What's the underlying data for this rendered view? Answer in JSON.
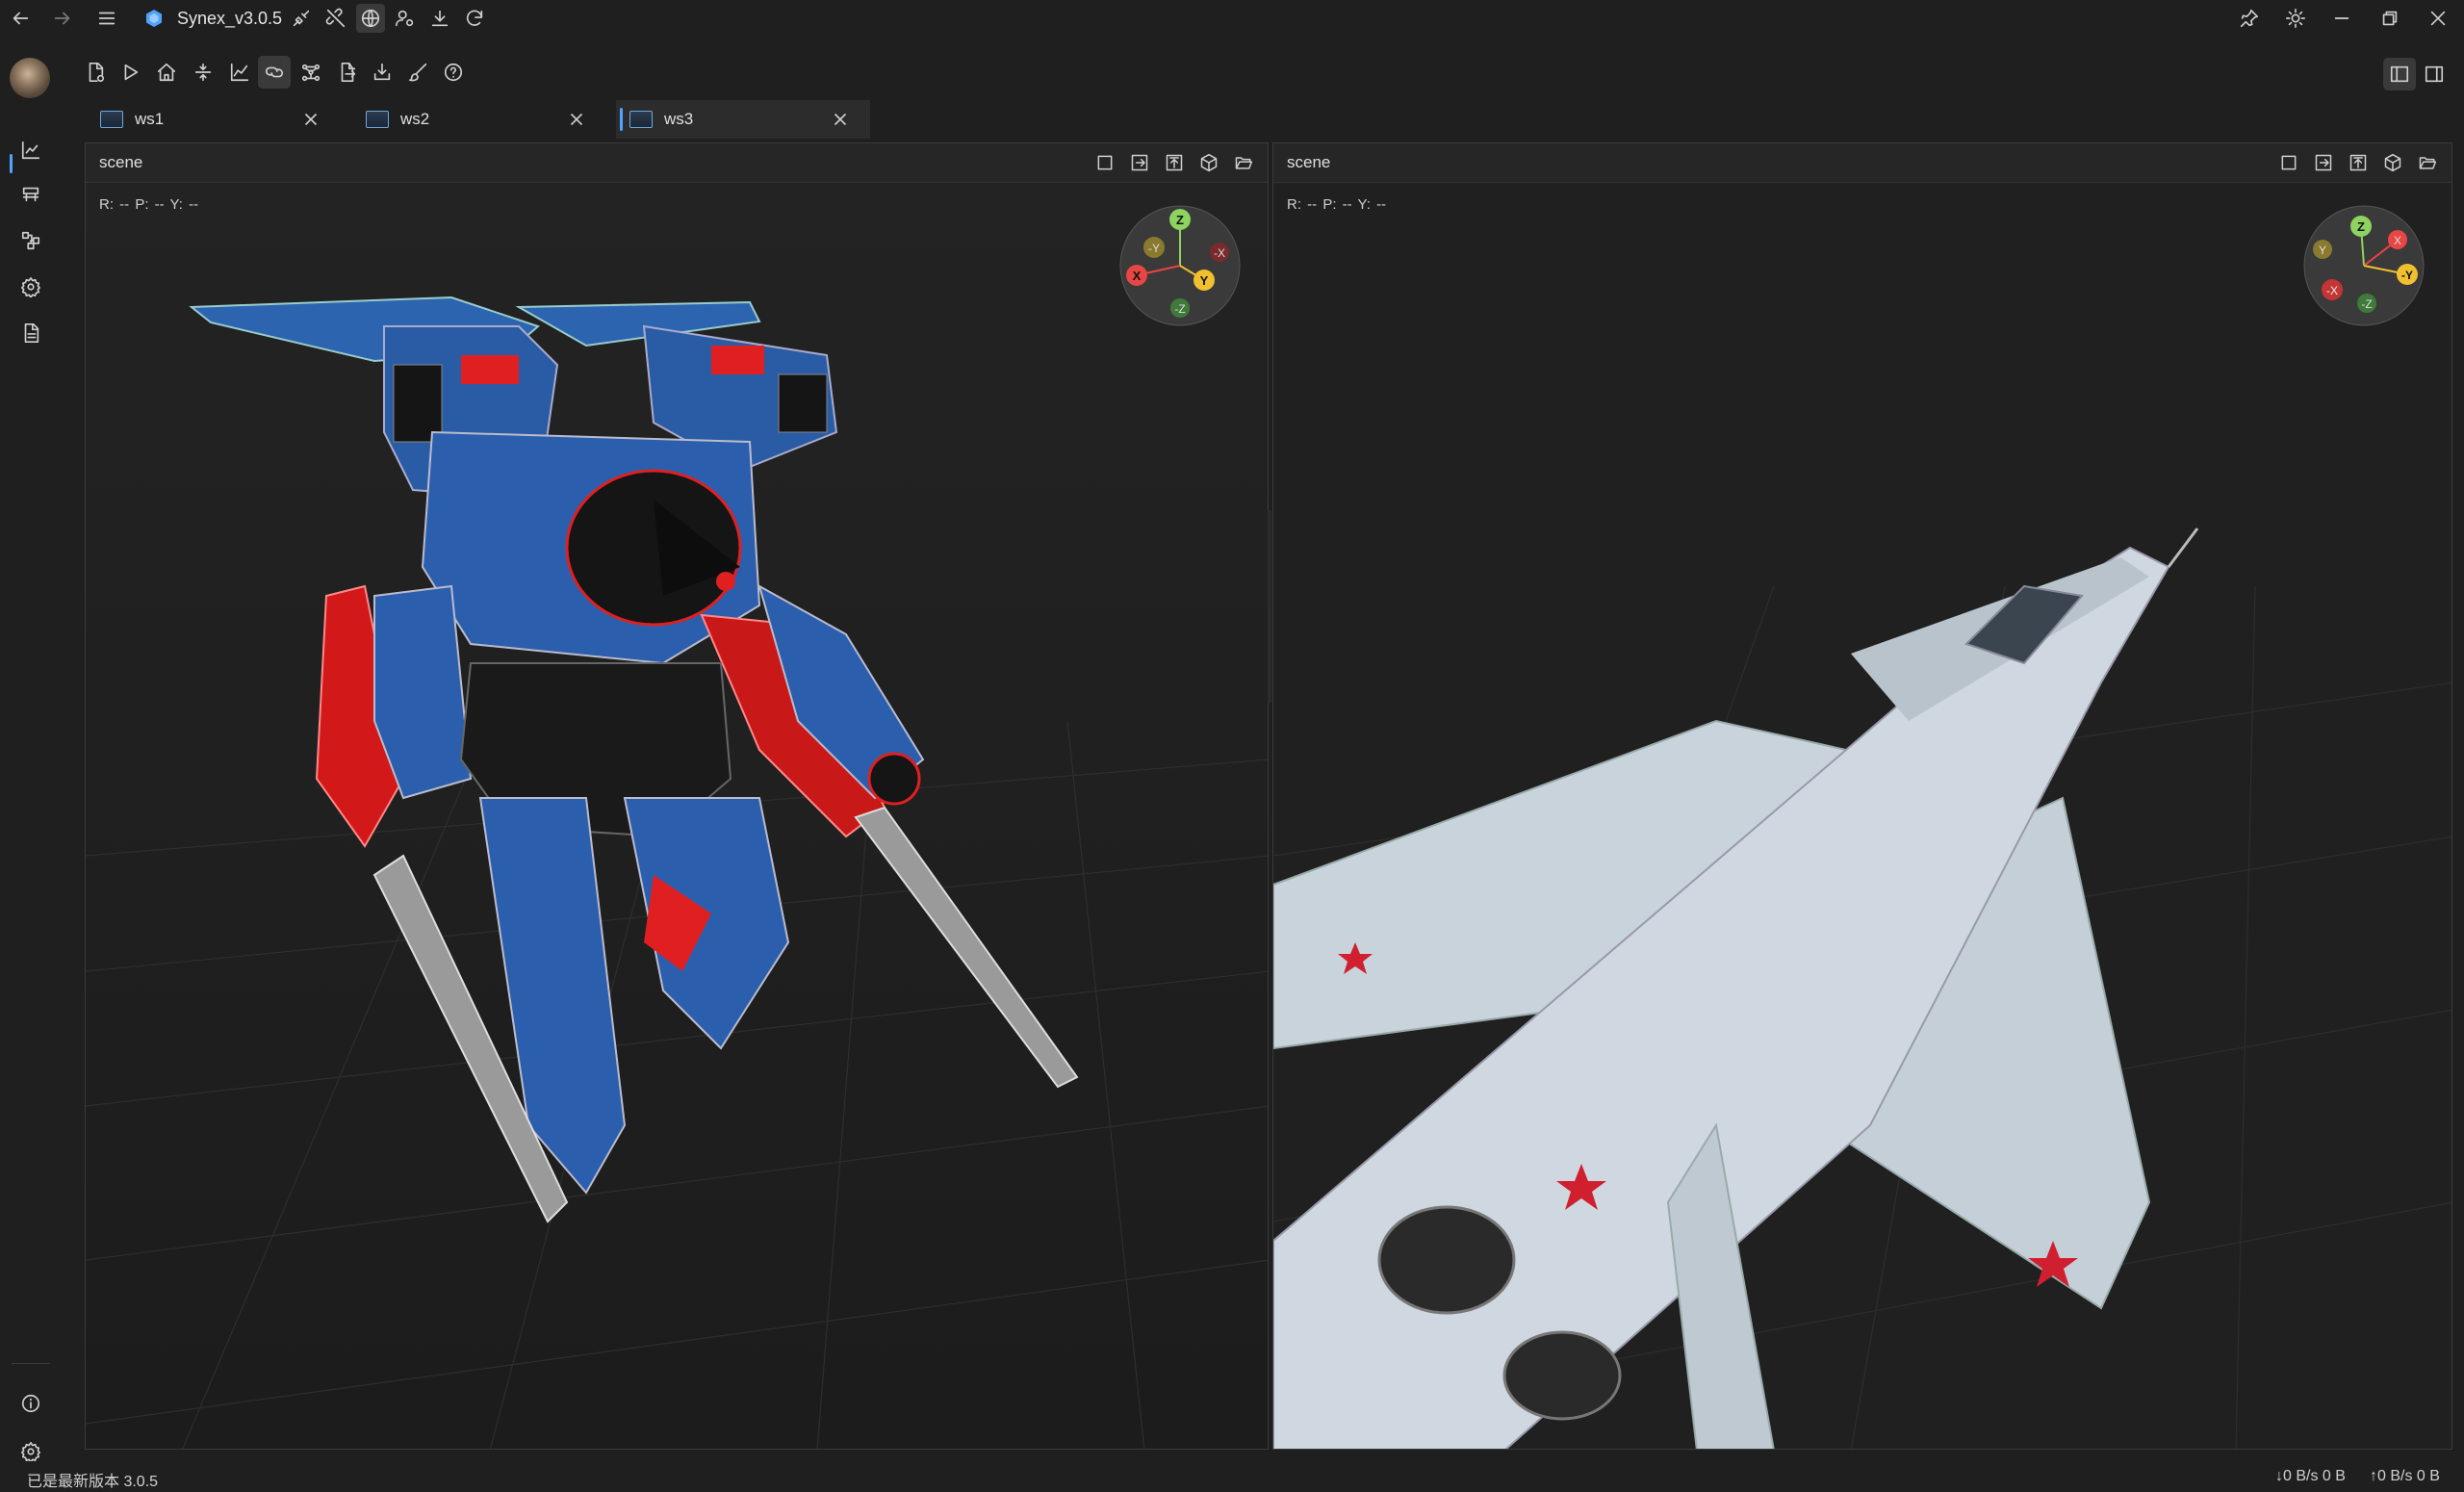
{
  "titlebar": {
    "app_title": "Synex_v3.0.5",
    "icons": [
      "back-arrow-icon",
      "forward-arrow-icon",
      "menu-icon",
      "app-logo-icon",
      "connect-icon",
      "disconnect-icon",
      "network-icon",
      "user-settings-icon",
      "download-icon",
      "refresh-icon",
      "pin-icon",
      "theme-sun-icon",
      "minimize-icon",
      "restore-icon",
      "close-icon"
    ]
  },
  "sidebar": {
    "items": [
      "chart-icon",
      "layers-icon",
      "graph-icon",
      "settings-gear-icon",
      "document-icon"
    ],
    "bottom": [
      "info-icon",
      "settings-icon"
    ]
  },
  "toolbar": {
    "tools": [
      "new-file-icon",
      "play-icon",
      "home-icon",
      "align-icon",
      "line-chart-icon",
      "link-icon",
      "topology-icon",
      "export-file-icon",
      "import-icon",
      "brush-icon",
      "help-icon"
    ]
  },
  "tabs": [
    {
      "label": "ws1",
      "active": false
    },
    {
      "label": "ws2",
      "active": false
    },
    {
      "label": "ws3",
      "active": true
    }
  ],
  "panels": [
    {
      "title": "scene",
      "rpy": "R: --   P: --   Y: --",
      "gizmo": [
        "Z",
        "-Y",
        "-X",
        "X",
        "Y",
        "-Z"
      ]
    },
    {
      "title": "scene",
      "rpy": "R: --   P: --   Y: --",
      "gizmo": [
        "Z",
        "X",
        "Y",
        "-Y",
        "-X",
        "-Z"
      ]
    }
  ],
  "status": {
    "left": "已是最新版本 3.0.5",
    "download": "↓0 B/s 0 B",
    "upload": "↑0 B/s 0 B"
  },
  "colors": {
    "accent": "#4fa3ff",
    "background": "#1f1f1f",
    "panel": "#212121"
  }
}
